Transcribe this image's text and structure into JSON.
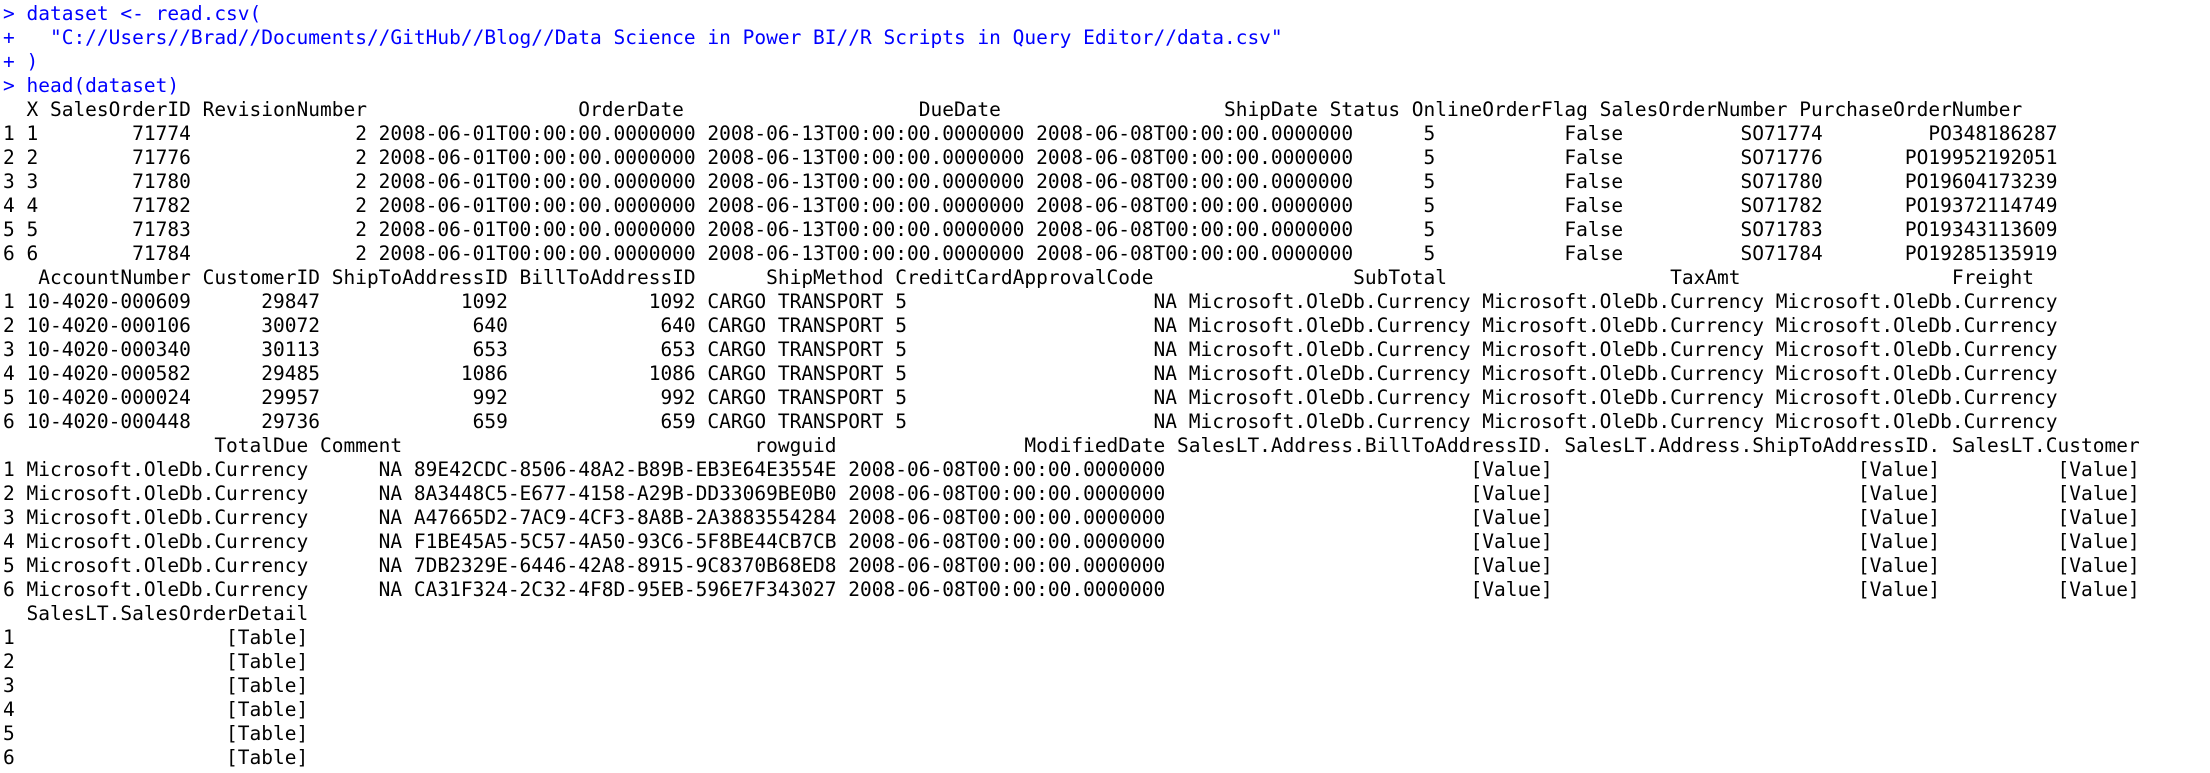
{
  "console": {
    "lines": [
      {
        "kind": "input",
        "text": "> dataset <- read.csv("
      },
      {
        "kind": "input",
        "text": "+   \"C://Users//Brad//Documents//GitHub//Blog//Data Science in Power BI//R Scripts in Query Editor//data.csv\""
      },
      {
        "kind": "input",
        "text": "+ )"
      },
      {
        "kind": "input",
        "text": "> head(dataset)"
      },
      {
        "kind": "output",
        "text": "  X SalesOrderID RevisionNumber                  OrderDate                    DueDate                   ShipDate Status OnlineOrderFlag SalesOrderNumber PurchaseOrderNumber"
      },
      {
        "kind": "output",
        "text": "1 1        71774              2 2008-06-01T00:00:00.0000000 2008-06-13T00:00:00.0000000 2008-06-08T00:00:00.0000000      5           False          SO71774         PO348186287"
      },
      {
        "kind": "output",
        "text": "2 2        71776              2 2008-06-01T00:00:00.0000000 2008-06-13T00:00:00.0000000 2008-06-08T00:00:00.0000000      5           False          SO71776       PO19952192051"
      },
      {
        "kind": "output",
        "text": "3 3        71780              2 2008-06-01T00:00:00.0000000 2008-06-13T00:00:00.0000000 2008-06-08T00:00:00.0000000      5           False          SO71780       PO19604173239"
      },
      {
        "kind": "output",
        "text": "4 4        71782              2 2008-06-01T00:00:00.0000000 2008-06-13T00:00:00.0000000 2008-06-08T00:00:00.0000000      5           False          SO71782       PO19372114749"
      },
      {
        "kind": "output",
        "text": "5 5        71783              2 2008-06-01T00:00:00.0000000 2008-06-13T00:00:00.0000000 2008-06-08T00:00:00.0000000      5           False          SO71783       PO19343113609"
      },
      {
        "kind": "output",
        "text": "6 6        71784              2 2008-06-01T00:00:00.0000000 2008-06-13T00:00:00.0000000 2008-06-08T00:00:00.0000000      5           False          SO71784       PO19285135919"
      },
      {
        "kind": "output",
        "text": "   AccountNumber CustomerID ShipToAddressID BillToAddressID      ShipMethod CreditCardApprovalCode                 SubTotal                   TaxAmt                  Freight"
      },
      {
        "kind": "output",
        "text": "1 10-4020-000609      29847            1092            1092 CARGO TRANSPORT 5                     NA Microsoft.OleDb.Currency Microsoft.OleDb.Currency Microsoft.OleDb.Currency"
      },
      {
        "kind": "output",
        "text": "2 10-4020-000106      30072             640             640 CARGO TRANSPORT 5                     NA Microsoft.OleDb.Currency Microsoft.OleDb.Currency Microsoft.OleDb.Currency"
      },
      {
        "kind": "output",
        "text": "3 10-4020-000340      30113             653             653 CARGO TRANSPORT 5                     NA Microsoft.OleDb.Currency Microsoft.OleDb.Currency Microsoft.OleDb.Currency"
      },
      {
        "kind": "output",
        "text": "4 10-4020-000582      29485            1086            1086 CARGO TRANSPORT 5                     NA Microsoft.OleDb.Currency Microsoft.OleDb.Currency Microsoft.OleDb.Currency"
      },
      {
        "kind": "output",
        "text": "5 10-4020-000024      29957             992             992 CARGO TRANSPORT 5                     NA Microsoft.OleDb.Currency Microsoft.OleDb.Currency Microsoft.OleDb.Currency"
      },
      {
        "kind": "output",
        "text": "6 10-4020-000448      29736             659             659 CARGO TRANSPORT 5                     NA Microsoft.OleDb.Currency Microsoft.OleDb.Currency Microsoft.OleDb.Currency"
      },
      {
        "kind": "output",
        "text": "                  TotalDue Comment                              rowguid                ModifiedDate SalesLT.Address.BillToAddressID. SalesLT.Address.ShipToAddressID. SalesLT.Customer"
      },
      {
        "kind": "output",
        "text": "1 Microsoft.OleDb.Currency      NA 89E42CDC-8506-48A2-B89B-EB3E64E3554E 2008-06-08T00:00:00.0000000                          [Value]                          [Value]          [Value]"
      },
      {
        "kind": "output",
        "text": "2 Microsoft.OleDb.Currency      NA 8A3448C5-E677-4158-A29B-DD33069BE0B0 2008-06-08T00:00:00.0000000                          [Value]                          [Value]          [Value]"
      },
      {
        "kind": "output",
        "text": "3 Microsoft.OleDb.Currency      NA A47665D2-7AC9-4CF3-8A8B-2A3883554284 2008-06-08T00:00:00.0000000                          [Value]                          [Value]          [Value]"
      },
      {
        "kind": "output",
        "text": "4 Microsoft.OleDb.Currency      NA F1BE45A5-5C57-4A50-93C6-5F8BE44CB7CB 2008-06-08T00:00:00.0000000                          [Value]                          [Value]          [Value]"
      },
      {
        "kind": "output",
        "text": "5 Microsoft.OleDb.Currency      NA 7DB2329E-6446-42A8-8915-9C8370B68ED8 2008-06-08T00:00:00.0000000                          [Value]                          [Value]          [Value]"
      },
      {
        "kind": "output",
        "text": "6 Microsoft.OleDb.Currency      NA CA31F324-2C32-4F8D-95EB-596E7F343027 2008-06-08T00:00:00.0000000                          [Value]                          [Value]          [Value]"
      },
      {
        "kind": "output",
        "text": "  SalesLT.SalesOrderDetail"
      },
      {
        "kind": "output",
        "text": "1                  [Table]"
      },
      {
        "kind": "output",
        "text": "2                  [Table]"
      },
      {
        "kind": "output",
        "text": "3                  [Table]"
      },
      {
        "kind": "output",
        "text": "4                  [Table]"
      },
      {
        "kind": "output",
        "text": "5                  [Table]"
      },
      {
        "kind": "output",
        "text": "6                  [Table]"
      },
      {
        "kind": "input",
        "text": ">"
      }
    ]
  },
  "colors": {
    "input": "#0000ff",
    "output": "#000000",
    "background": "#ffffff"
  }
}
